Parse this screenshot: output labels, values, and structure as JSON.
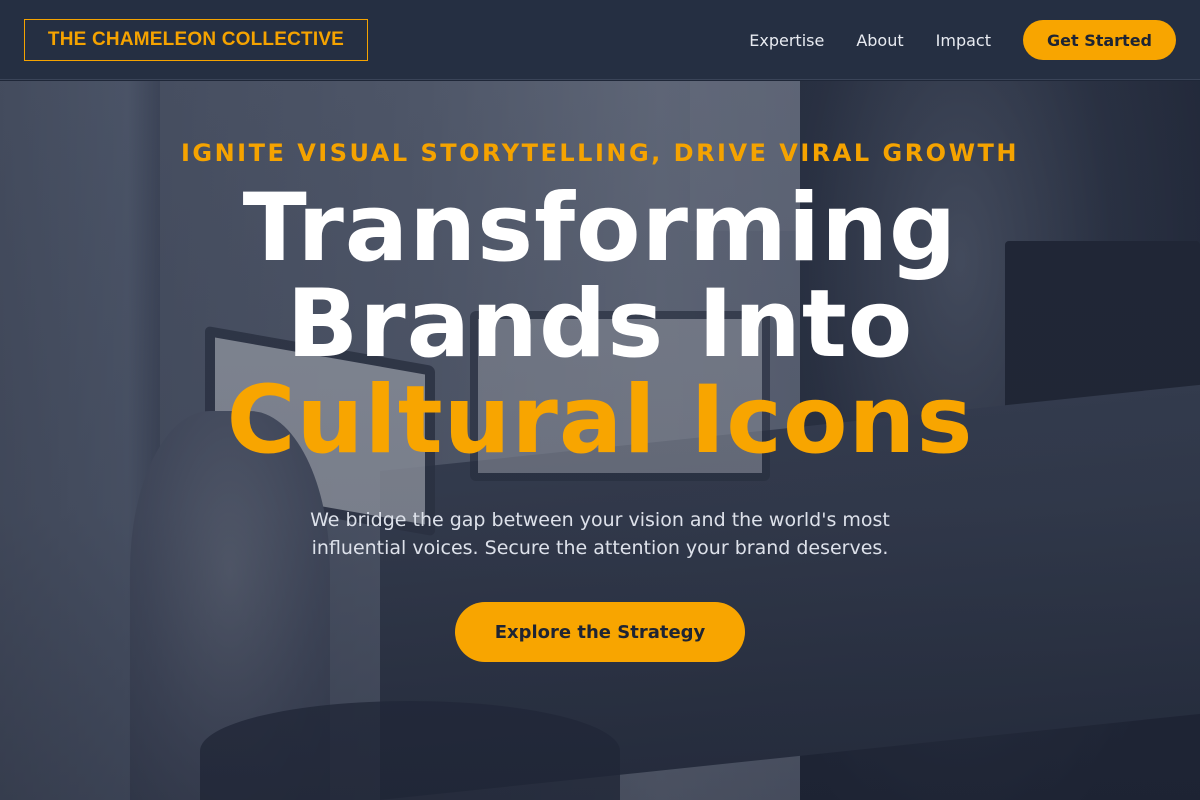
{
  "header": {
    "logo_text": "THE CHAMELEON COLLECTIVE",
    "nav": {
      "expertise": "Expertise",
      "about": "About",
      "impact": "Impact"
    },
    "cta_label": "Get Started"
  },
  "hero": {
    "eyebrow": "IGNITE VISUAL STORYTELLING, DRIVE VIRAL GROWTH",
    "headline_line1": "Transforming",
    "headline_line2": "Brands Into",
    "headline_accent": "Cultural Icons",
    "subtext": "We bridge the gap between your vision and the world's most influential voices. Secure the attention your brand deserves.",
    "cta_label": "Explore the Strategy",
    "background_image": "office workspace photo with people at laptops"
  },
  "colors": {
    "accent": "#f8a500",
    "nav_background": "#252f42",
    "text_light": "#ffffff"
  }
}
